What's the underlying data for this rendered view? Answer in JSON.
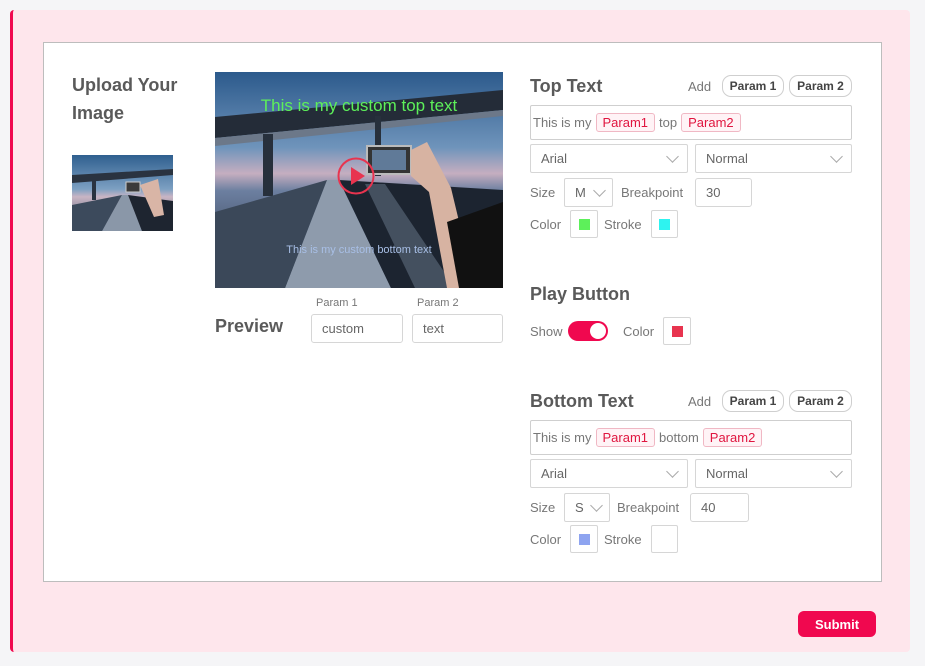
{
  "upload": {
    "title": "Upload Your Image"
  },
  "preview": {
    "label": "Preview",
    "overlay_top": "This is my custom top text",
    "overlay_bottom": "This is my custom bottom text",
    "param1_label": "Param 1",
    "param2_label": "Param 2",
    "param1_value": "custom",
    "param2_value": "text"
  },
  "top_text": {
    "title": "Top Text",
    "add_label": "Add",
    "param1_button": "Param 1",
    "param2_button": "Param 2",
    "text_prefix": "This is my",
    "tag1": "Param1",
    "text_middle": "top",
    "tag2": "Param2",
    "font": "Arial",
    "weight": "Normal",
    "size_label": "Size",
    "size_value": "M",
    "breakpoint_label": "Breakpoint",
    "breakpoint_value": "30",
    "color_label": "Color",
    "stroke_label": "Stroke",
    "color": "#5df05a",
    "stroke": "#2ef3f0"
  },
  "play_button": {
    "title": "Play Button",
    "show_label": "Show",
    "show_enabled": true,
    "color_label": "Color",
    "color": "#e8344f"
  },
  "bottom_text": {
    "title": "Bottom Text",
    "add_label": "Add",
    "param1_button": "Param 1",
    "param2_button": "Param 2",
    "text_prefix": "This is my",
    "tag1": "Param1",
    "text_middle": "bottom",
    "tag2": "Param2",
    "font": "Arial",
    "weight": "Normal",
    "size_label": "Size",
    "size_value": "S",
    "breakpoint_label": "Breakpoint",
    "breakpoint_value": "40",
    "color_label": "Color",
    "stroke_label": "Stroke",
    "color": "#8ea4f0",
    "stroke": "#ffffff"
  },
  "submit_label": "Submit",
  "colors": {
    "accent": "#f0084f",
    "panel_bg": "#fee6ec"
  }
}
